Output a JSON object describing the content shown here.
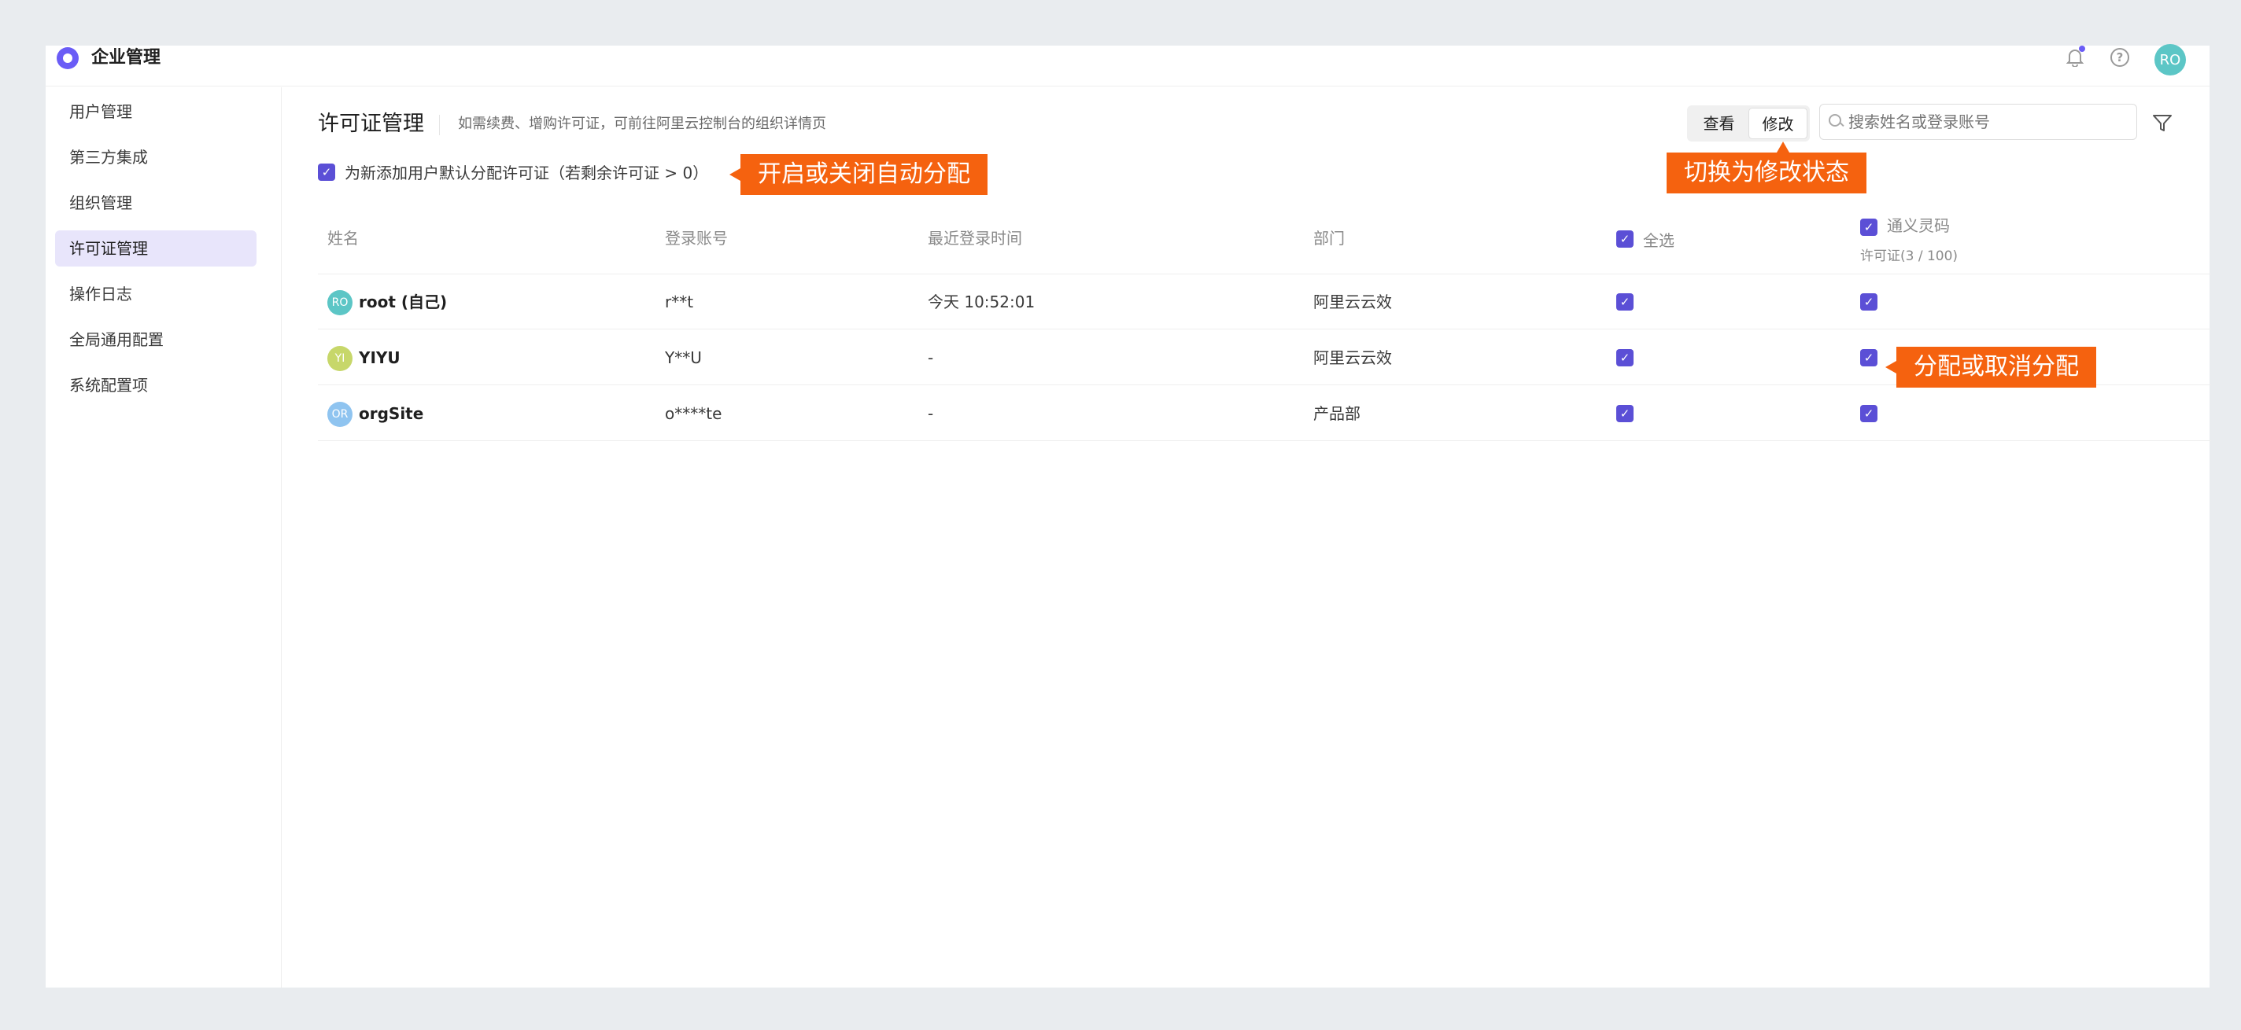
{
  "header": {
    "app_title": "企业管理",
    "user_initials": "RO",
    "help_glyph": "?"
  },
  "sidebar": {
    "items": [
      {
        "label": "用户管理"
      },
      {
        "label": "第三方集成"
      },
      {
        "label": "组织管理"
      },
      {
        "label": "许可证管理",
        "active": true
      },
      {
        "label": "操作日志"
      },
      {
        "label": "全局通用配置"
      },
      {
        "label": "系统配置项"
      }
    ]
  },
  "main": {
    "title": "许可证管理",
    "description": "如需续费、增购许可证，可前往阿里云控制台的组织详情页",
    "auto_assign_label": "为新添加用户默认分配许可证（若剩余许可证 > 0）",
    "view_toggle": {
      "view": "查看",
      "edit": "修改",
      "active": "edit"
    },
    "search": {
      "placeholder": "搜索姓名或登录账号"
    }
  },
  "callouts": {
    "auto_assign": "开启或关闭自动分配",
    "switch_mode": "切换为修改状态",
    "assign": "分配或取消分配"
  },
  "table": {
    "columns": {
      "name": "姓名",
      "account": "登录账号",
      "last_login": "最近登录时间",
      "department": "部门",
      "select_all": "全选",
      "license": "通义灵码",
      "license_usage": "许可证(3 / 100)"
    },
    "rows": [
      {
        "initials": "RO",
        "avatar_color": "#5cc6c6",
        "name": "root (自己)",
        "account": "r**t",
        "last_login": "今天 10:52:01",
        "department": "阿里云云效",
        "selected": true,
        "licensed": true
      },
      {
        "initials": "YI",
        "avatar_color": "#c7d76a",
        "name": "YIYU",
        "account": "Y**U",
        "last_login": "-",
        "department": "阿里云云效",
        "selected": true,
        "licensed": true
      },
      {
        "initials": "OR",
        "avatar_color": "#8fc4f0",
        "name": "orgSite",
        "account": "o****te",
        "last_login": "-",
        "department": "产品部",
        "selected": true,
        "licensed": true
      }
    ]
  },
  "colors": {
    "accent": "#5b4fd6",
    "callout": "#f5620f",
    "active_nav_bg": "#e8e5fb"
  }
}
